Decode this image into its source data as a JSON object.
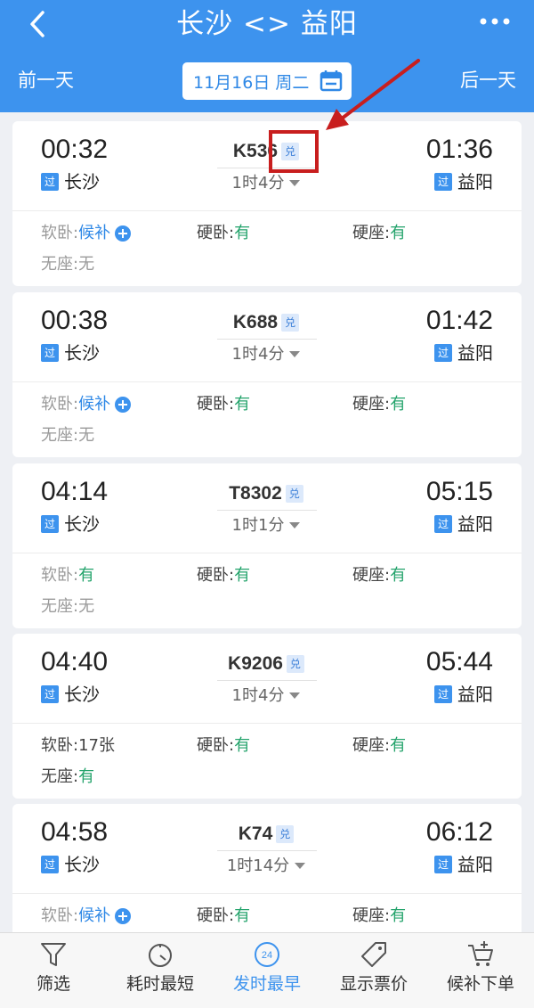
{
  "header": {
    "title": "长沙 <> 益阳",
    "prev_day": "前一天",
    "next_day": "后一天",
    "date": "11月16日 周二"
  },
  "trains": [
    {
      "dep_time": "00:32",
      "dep_badge": "过",
      "dep_station": "长沙",
      "train": "K536",
      "exchange": "兑",
      "duration": "1时4分",
      "arr_time": "01:36",
      "arr_badge": "过",
      "arr_station": "益阳",
      "seats": [
        {
          "label": "软卧: ",
          "value": "候补"
        },
        {
          "label": "硬卧: ",
          "value": "有"
        },
        {
          "label": "硬座: ",
          "value": "有"
        },
        {
          "label": "无座: ",
          "value": "无"
        }
      ]
    },
    {
      "dep_time": "00:38",
      "dep_badge": "过",
      "dep_station": "长沙",
      "train": "K688",
      "exchange": "兑",
      "duration": "1时4分",
      "arr_time": "01:42",
      "arr_badge": "过",
      "arr_station": "益阳",
      "seats": [
        {
          "label": "软卧: ",
          "value": "候补"
        },
        {
          "label": "硬卧: ",
          "value": "有"
        },
        {
          "label": "硬座: ",
          "value": "有"
        },
        {
          "label": "无座: ",
          "value": "无"
        }
      ]
    },
    {
      "dep_time": "04:14",
      "dep_badge": "过",
      "dep_station": "长沙",
      "train": "T8302",
      "exchange": "兑",
      "duration": "1时1分",
      "arr_time": "05:15",
      "arr_badge": "过",
      "arr_station": "益阳",
      "seats": [
        {
          "label": "软卧: ",
          "value": "有"
        },
        {
          "label": "硬卧: ",
          "value": "有"
        },
        {
          "label": "硬座: ",
          "value": "有"
        },
        {
          "label": "无座: ",
          "value": "无"
        }
      ]
    },
    {
      "dep_time": "04:40",
      "dep_badge": "过",
      "dep_station": "长沙",
      "train": "K9206",
      "exchange": "兑",
      "duration": "1时4分",
      "arr_time": "05:44",
      "arr_badge": "过",
      "arr_station": "益阳",
      "seats": [
        {
          "label": "软卧: ",
          "value": "17张"
        },
        {
          "label": "硬卧: ",
          "value": "有"
        },
        {
          "label": "硬座: ",
          "value": "有"
        },
        {
          "label": "无座: ",
          "value": "有"
        }
      ]
    },
    {
      "dep_time": "04:58",
      "dep_badge": "过",
      "dep_station": "长沙",
      "train": "K74",
      "exchange": "兑",
      "duration": "1时14分",
      "arr_time": "06:12",
      "arr_badge": "过",
      "arr_station": "益阳",
      "seats": [
        {
          "label": "软卧: ",
          "value": "候补"
        },
        {
          "label": "硬卧: ",
          "value": "有"
        },
        {
          "label": "硬座: ",
          "value": "有"
        }
      ]
    }
  ],
  "tabbar": [
    {
      "label": "筛选",
      "icon": "filter-icon"
    },
    {
      "label": "耗时最短",
      "icon": "timer-icon"
    },
    {
      "label": "发时最早",
      "icon": "clock-24-icon",
      "badge": "24"
    },
    {
      "label": "显示票价",
      "icon": "price-tag-icon"
    },
    {
      "label": "候补下单",
      "icon": "cart-plus-icon"
    }
  ],
  "colors": {
    "accent": "#3d93ee",
    "available": "#23a36b",
    "waitlist": "#2f88e6",
    "annotation": "#c81e1e"
  }
}
